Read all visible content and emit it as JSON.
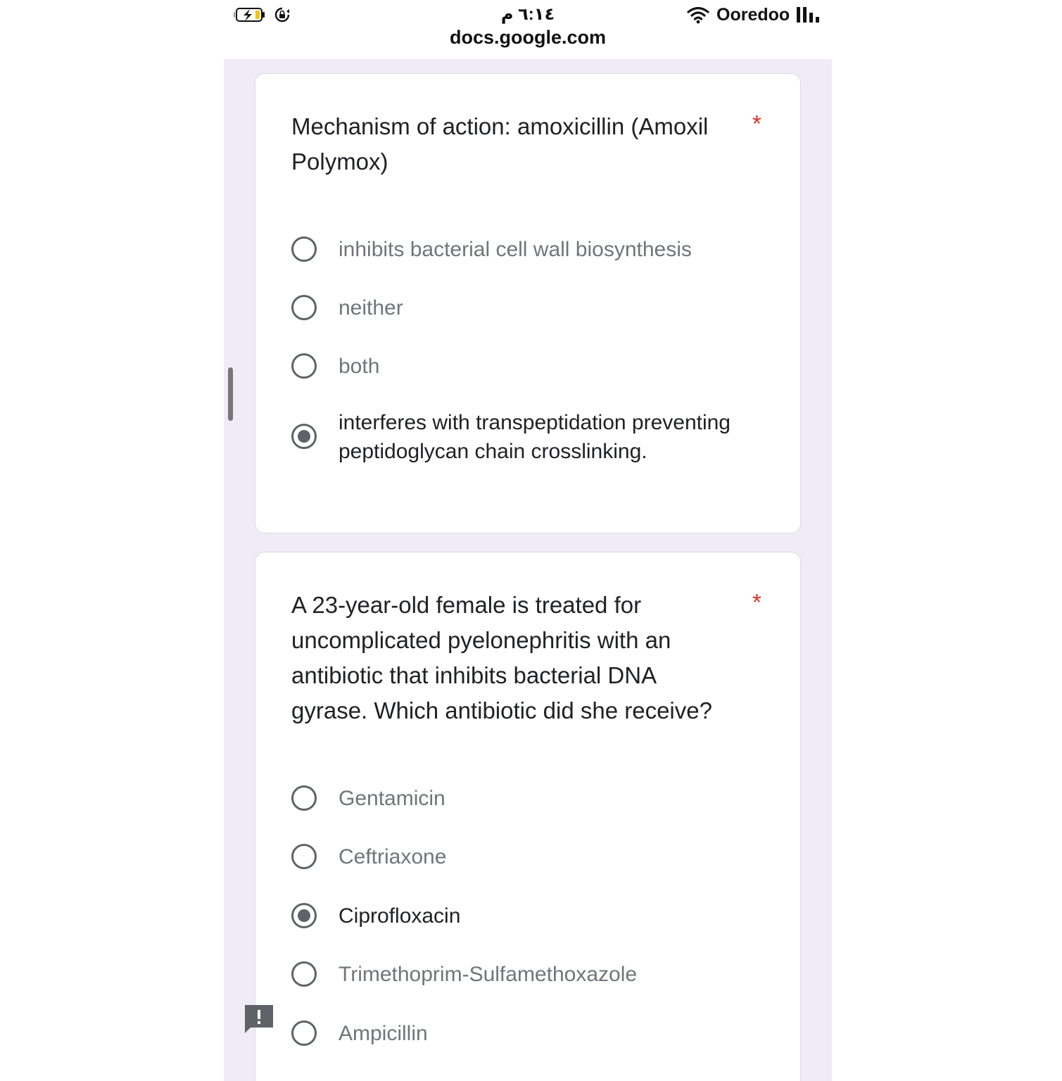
{
  "status_bar": {
    "time": "٦:١٤ م",
    "url": "docs.google.com",
    "carrier": "Ooredoo",
    "icons": [
      "battery-charging-icon",
      "rotation-lock-icon",
      "wifi-icon",
      "signal-bars-icon"
    ]
  },
  "questions": [
    {
      "title": "Mechanism of action: amoxicillin (Amoxil Polymox)",
      "required_mark": "*",
      "options": [
        {
          "label": "inhibits bacterial cell wall biosynthesis",
          "selected": false
        },
        {
          "label": "neither",
          "selected": false
        },
        {
          "label": "both",
          "selected": false
        },
        {
          "label": "interferes with transpeptidation preventing peptidoglycan chain crosslinking.",
          "selected": true
        }
      ]
    },
    {
      "title": "A 23-year-old female is treated for uncomplicated pyelonephritis with an antibiotic that inhibits bacterial DNA gyrase. Which antibiotic did she receive?",
      "required_mark": "*",
      "options": [
        {
          "label": "Gentamicin",
          "selected": false
        },
        {
          "label": "Ceftriaxone",
          "selected": false
        },
        {
          "label": "Ciprofloxacin",
          "selected": true
        },
        {
          "label": "Trimethoprim-Sulfamethoxazole",
          "selected": false
        },
        {
          "label": "Ampicillin",
          "selected": false
        }
      ]
    }
  ],
  "colors": {
    "page_background": "#efebf7",
    "card_background": "#ffffff",
    "required_star": "#d93025",
    "radio": "#5f6368",
    "option_text": "#70757a",
    "selected_option_text": "#202124"
  }
}
